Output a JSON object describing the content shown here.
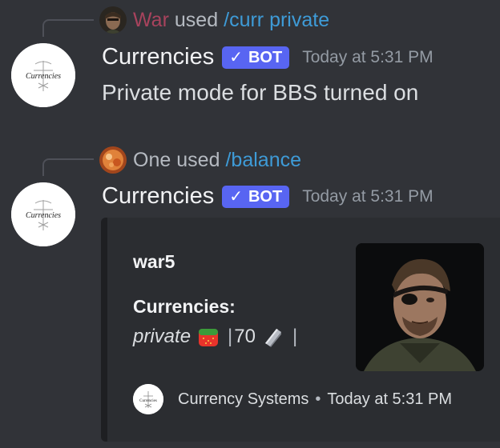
{
  "messages": [
    {
      "reply": {
        "user": "War",
        "user_color": "#a8435d",
        "verb": "used",
        "command": "/curr private"
      },
      "author": "Currencies",
      "bot_tag": "BOT",
      "timestamp": "Today at 5:31 PM",
      "content": "Private mode for BBS turned on",
      "avatar_text": "Currencies"
    },
    {
      "reply": {
        "user": "One",
        "user_color": "#b5bac1",
        "verb": "used",
        "command": "/balance"
      },
      "author": "Currencies",
      "bot_tag": "BOT",
      "timestamp": "Today at 5:31 PM",
      "avatar_text": "Currencies",
      "embed": {
        "title": "war5",
        "field_name": "Currencies:",
        "field_value": {
          "label": "private",
          "icon1": "strawberry-icon",
          "sep1": "|",
          "amount": "70",
          "icon2": "silver-bar-icon",
          "sep2": "|"
        },
        "footer_text": "Currency Systems",
        "footer_sep": "•",
        "footer_time": "Today at 5:31 PM",
        "footer_icon_text": "Currencies"
      }
    }
  ]
}
